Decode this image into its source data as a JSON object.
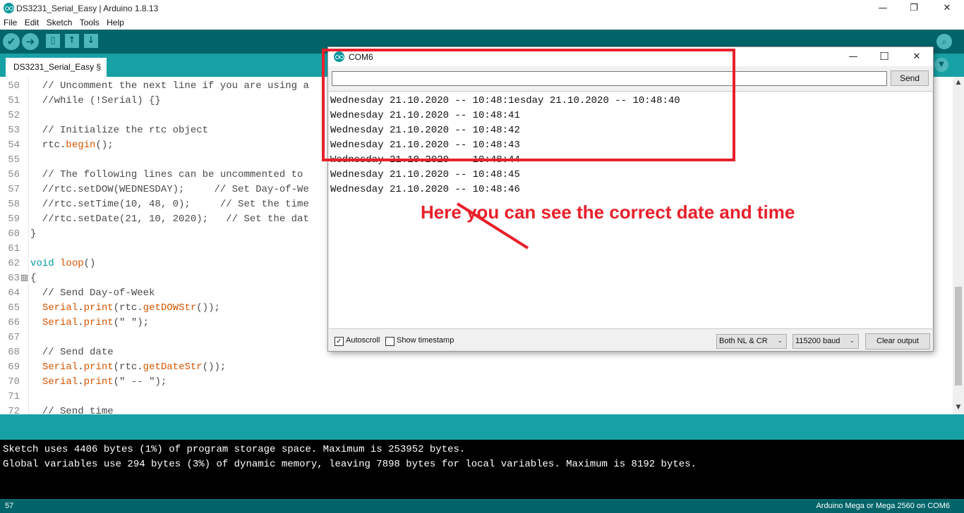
{
  "window": {
    "title": "DS3231_Serial_Easy | Arduino 1.8.13",
    "minimize_glyph": "—",
    "restore_glyph": "❐",
    "close_glyph": "✕"
  },
  "menu": [
    "File",
    "Edit",
    "Sketch",
    "Tools",
    "Help"
  ],
  "toolbar": {
    "verify_icon": "✔",
    "upload_icon": "➜",
    "new_icon": "▯",
    "open_icon": "↑",
    "save_icon": "↓",
    "serial_icon": "⌕"
  },
  "tab": {
    "label": "DS3231_Serial_Easy §",
    "menu_icon": "▼"
  },
  "editor": {
    "lines": [
      {
        "num": "50",
        "text": "  // Uncomment the next line if you are using a"
      },
      {
        "num": "51",
        "text": "  //while (!Serial) {}"
      },
      {
        "num": "52",
        "text": ""
      },
      {
        "num": "53",
        "text": "  // Initialize the rtc object"
      },
      {
        "num": "54",
        "text": "  rtc.begin();"
      },
      {
        "num": "55",
        "text": ""
      },
      {
        "num": "56",
        "text": "  // The following lines can be uncommented to"
      },
      {
        "num": "57",
        "text": "  //rtc.setDOW(WEDNESDAY);     // Set Day-of-We"
      },
      {
        "num": "58",
        "text": "  //rtc.setTime(10, 48, 0);     // Set the time"
      },
      {
        "num": "59",
        "text": "  //rtc.setDate(21, 10, 2020);   // Set the dat"
      },
      {
        "num": "60",
        "text": "}"
      },
      {
        "num": "61",
        "text": ""
      },
      {
        "num": "62",
        "text": "void loop()"
      },
      {
        "num": "63",
        "text": "{"
      },
      {
        "num": "64",
        "text": "  // Send Day-of-Week"
      },
      {
        "num": "65",
        "text": "  Serial.print(rtc.getDOWStr());"
      },
      {
        "num": "66",
        "text": "  Serial.print(\" \");"
      },
      {
        "num": "67",
        "text": ""
      },
      {
        "num": "68",
        "text": "  // Send date"
      },
      {
        "num": "69",
        "text": "  Serial.print(rtc.getDateStr());"
      },
      {
        "num": "70",
        "text": "  Serial.print(\" -- \");"
      },
      {
        "num": "71",
        "text": ""
      },
      {
        "num": "72",
        "text": "  // Send time"
      }
    ],
    "fold_glyph": "⊟",
    "scroll_up": "▲",
    "scroll_down": "▼"
  },
  "console": {
    "lines": [
      "Sketch uses 4406 bytes (1%) of program storage space. Maximum is 253952 bytes.",
      "Global variables use 294 bytes (3%) of dynamic memory, leaving 7898 bytes for local variables. Maximum is 8192 bytes."
    ]
  },
  "status": {
    "line_number": "57",
    "board": "Arduino Mega or Mega 2560 on COM6"
  },
  "serial_monitor": {
    "title": "COM6",
    "input_value": "",
    "send_label": "Send",
    "output_lines": [
      "Wednesday 21.10.2020 -- 10:48:1esday 21.10.2020 -- 10:48:40",
      "Wednesday 21.10.2020 -- 10:48:41",
      "Wednesday 21.10.2020 -- 10:48:42",
      "Wednesday 21.10.2020 -- 10:48:43",
      "Wednesday 21.10.2020 -- 10:48:44",
      "Wednesday 21.10.2020 -- 10:48:45",
      "Wednesday 21.10.2020 -- 10:48:46"
    ],
    "autoscroll_label": "Autoscroll",
    "autoscroll_checked": true,
    "timestamp_label": "Show timestamp",
    "timestamp_checked": false,
    "line_ending": "Both NL & CR",
    "baud": "115200 baud",
    "clear_label": "Clear output",
    "check_glyph": "✓",
    "chevron": "⌄"
  },
  "annotation": {
    "text": "Here you can see the correct date and time",
    "color": "#e8202b"
  },
  "colors": {
    "toolbar_bg": "#006468",
    "tabbar_bg": "#17a1a5",
    "accent": "#00979c",
    "console_bg": "#000000"
  }
}
